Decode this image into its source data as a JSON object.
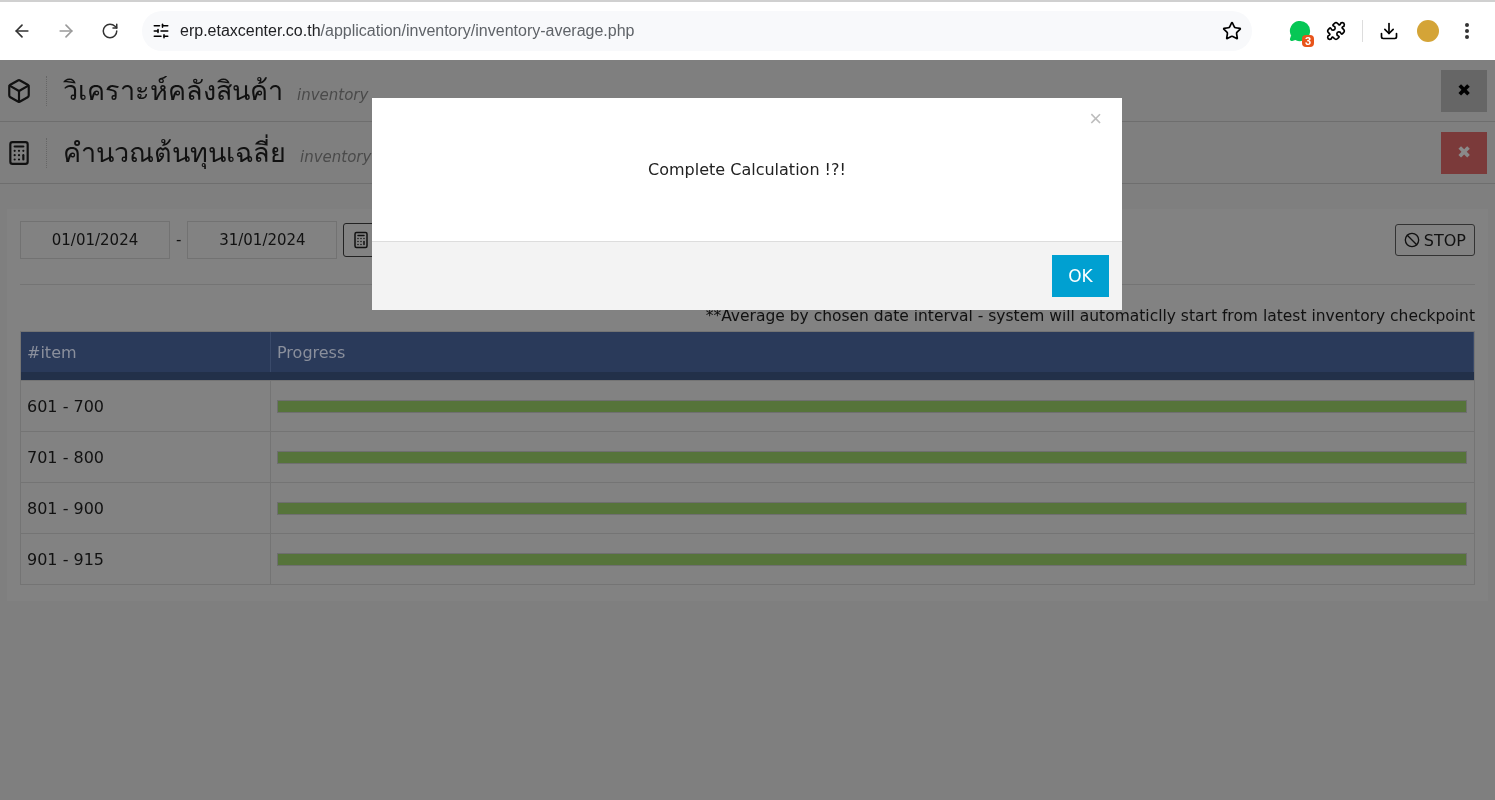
{
  "browser": {
    "url_host": "erp.etaxcenter.co.th",
    "url_path": "/application/inventory/inventory-average.php",
    "forward_disabled": true,
    "extension_badge": "3"
  },
  "headers": [
    {
      "kind": "cube",
      "title": "วิเคราะห์คลังสินค้า",
      "subtitle": "inventory",
      "close_button": {
        "kind": "dark",
        "label": "✖"
      }
    },
    {
      "kind": "calculator",
      "title": "คำนวณต้นทุนเฉลี่ย",
      "subtitle": "inventory",
      "close_button": {
        "kind": "danger",
        "label": "✖"
      }
    }
  ],
  "filter": {
    "date_from": "01/01/2024",
    "separator": "-",
    "date_to": "31/01/2024",
    "stop_label": "STOP"
  },
  "note": "**Average by chosen date interval - system will automaticlly start from latest inventory checkpoint",
  "table": {
    "columns": [
      "#item",
      "Progress"
    ],
    "rows": [
      {
        "item": "601 - 700",
        "level": 1
      },
      {
        "item": "701 - 800",
        "level": 1
      },
      {
        "item": "801 - 900",
        "level": 1
      },
      {
        "item": "901 - 915",
        "level": 1
      }
    ]
  },
  "dialog": {
    "close_label": "×",
    "message": "Complete Calculation !?!",
    "ok_label": "OK"
  }
}
